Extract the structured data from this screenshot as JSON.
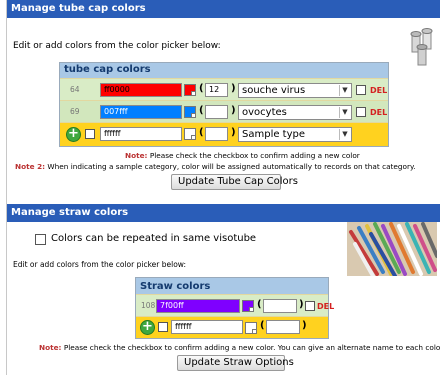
{
  "tube": {
    "heading": "Manage tube cap colors",
    "instruction": "Edit or add colors from the color picker below:",
    "box_title": "tube cap colors",
    "rows": [
      {
        "num": "64",
        "hex": "ff0000",
        "color": "#ff0000",
        "order": "12",
        "category": "souche virus",
        "del": "DEL"
      },
      {
        "num": "69",
        "hex": "007fff",
        "color": "#007fff",
        "order": "",
        "category": "ovocytes",
        "del": "DEL"
      }
    ],
    "new_row": {
      "hex": "ffffff",
      "order": "",
      "category": "Sample type"
    },
    "note1_label": "Note:",
    "note1_text": "Please check the checkbox to confirm adding a new color",
    "note2_label": "Note 2:",
    "note2_text": "When indicating a sample category, color will be assigned automatically to records on that category.",
    "button": "Update Tube Cap Colors"
  },
  "straw": {
    "heading": "Manage straw colors",
    "repeat_label": "Colors can be repeated in same visotube",
    "instruction": "Edit or add colors from the color picker below:",
    "box_title": "Straw colors",
    "rows": [
      {
        "num": "108",
        "hex": "7f00ff",
        "color": "#7f00ff",
        "order": "",
        "del": "DEL"
      }
    ],
    "new_row": {
      "hex": "ffffff",
      "order": ""
    },
    "note_label": "Note:",
    "note_text": "Please check the checkbox to confirm adding a new color. You can give an alternate name to each color.",
    "button": "Update Straw Options"
  },
  "colors": {
    "header": "#2a5db8",
    "box_header": "#a9c8e6",
    "row_even": "#d9ecc6",
    "row_odd": "#d2e7bd",
    "new_row": "#ffd21f"
  }
}
